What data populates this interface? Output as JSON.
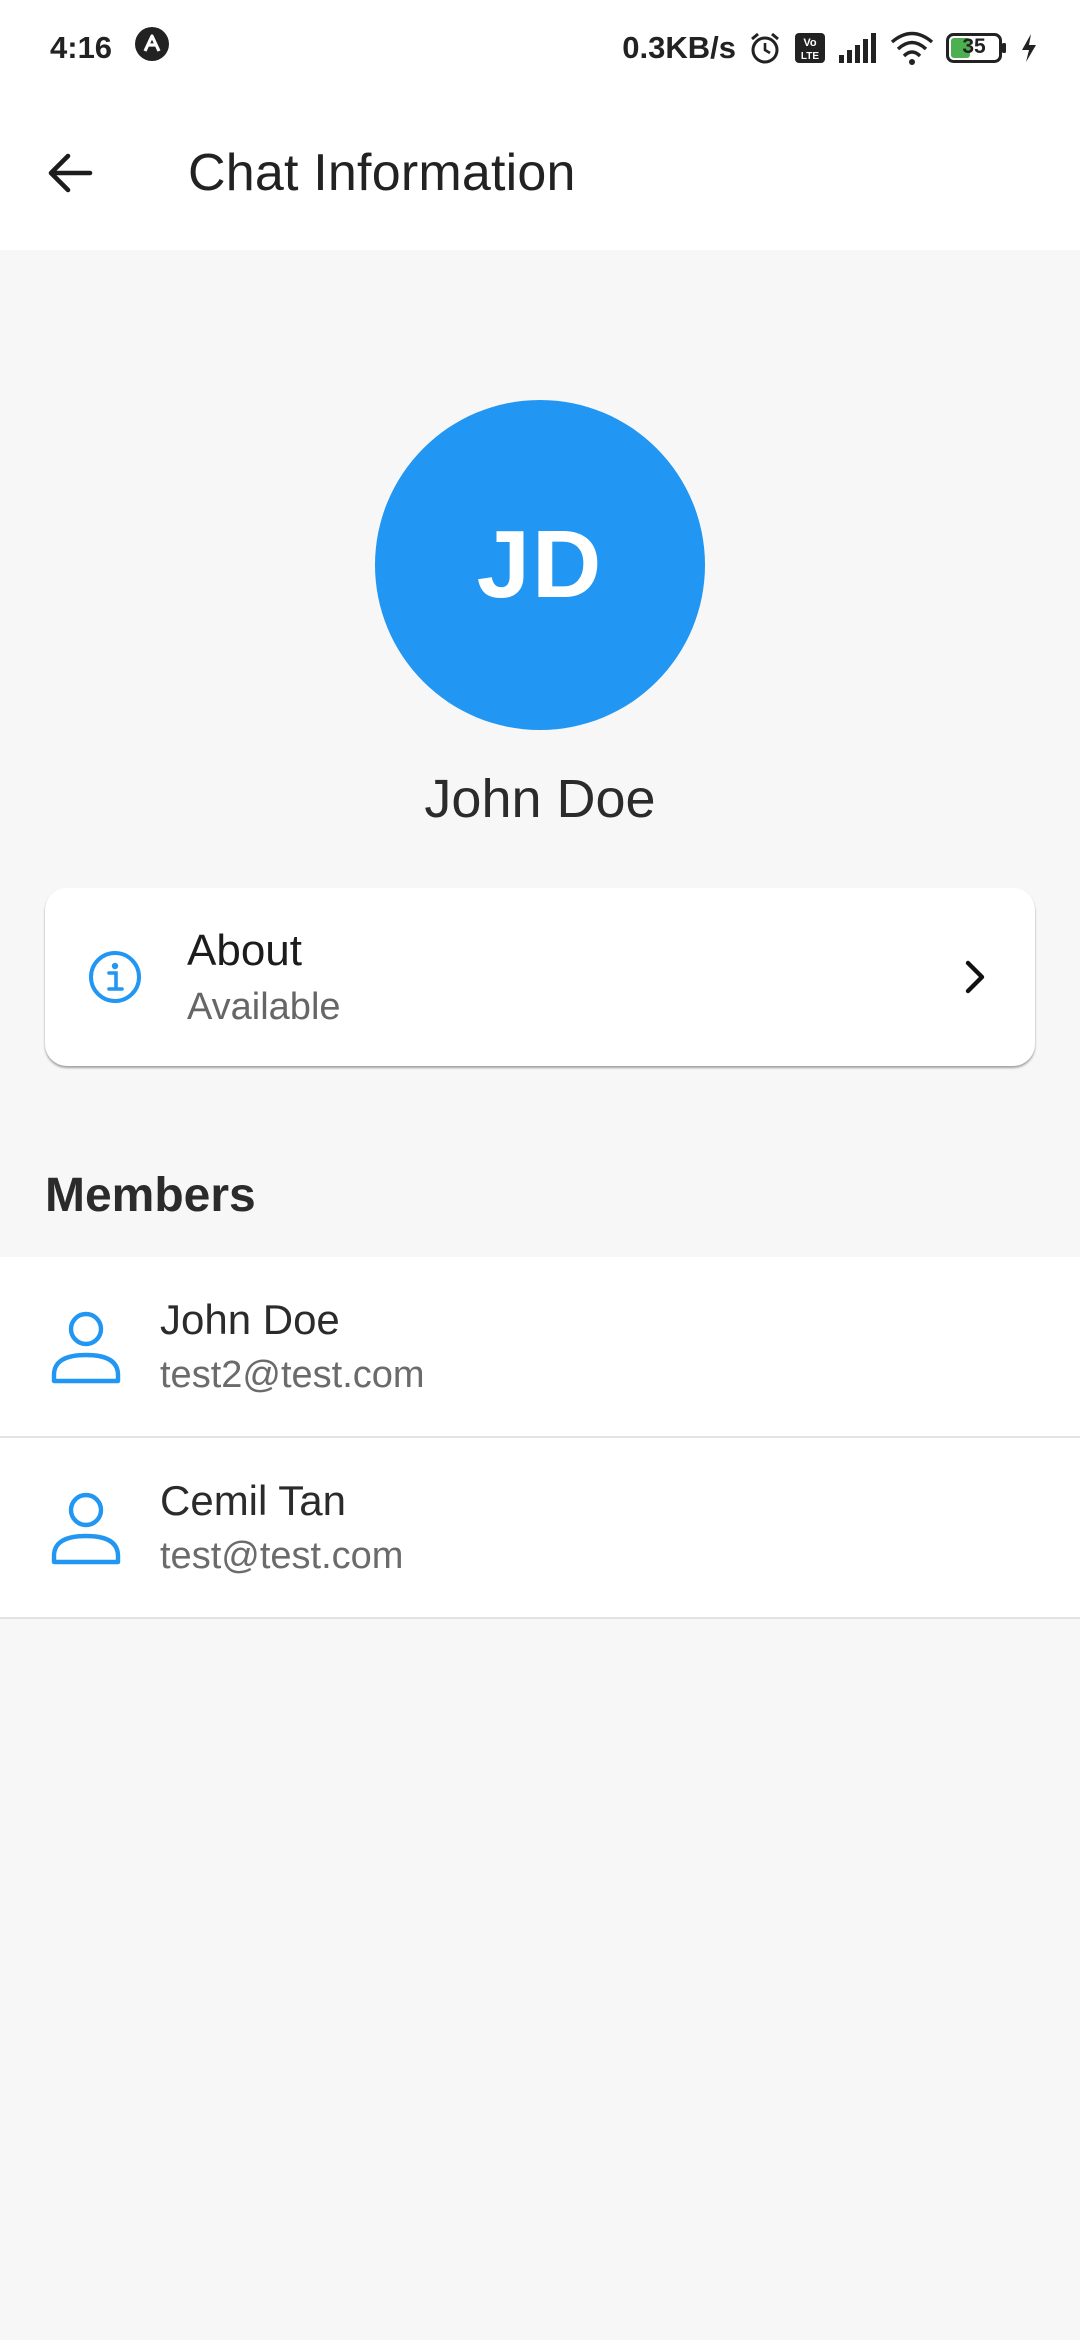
{
  "status_bar": {
    "time": "4:16",
    "speed": "0.3KB/s",
    "battery": "35",
    "icons": [
      "app-notification-icon",
      "alarm-icon",
      "volte-icon",
      "signal-icon",
      "wifi-icon",
      "battery-icon",
      "charging-icon"
    ]
  },
  "app_bar": {
    "back_icon": "arrow-left-icon",
    "title": "Chat Information"
  },
  "profile": {
    "initials": "JD",
    "name": "John Doe",
    "avatar_color": "#2196f3"
  },
  "about": {
    "icon": "info-icon",
    "title": "About",
    "subtitle": "Available"
  },
  "members": {
    "title": "Members",
    "items": [
      {
        "name": "John Doe",
        "email": "test2@test.com",
        "icon": "person-icon"
      },
      {
        "name": "Cemil Tan",
        "email": "test@test.com",
        "icon": "person-icon"
      }
    ]
  },
  "colors": {
    "accent": "#2196f3",
    "background": "#f7f7f7",
    "surface": "#ffffff"
  }
}
